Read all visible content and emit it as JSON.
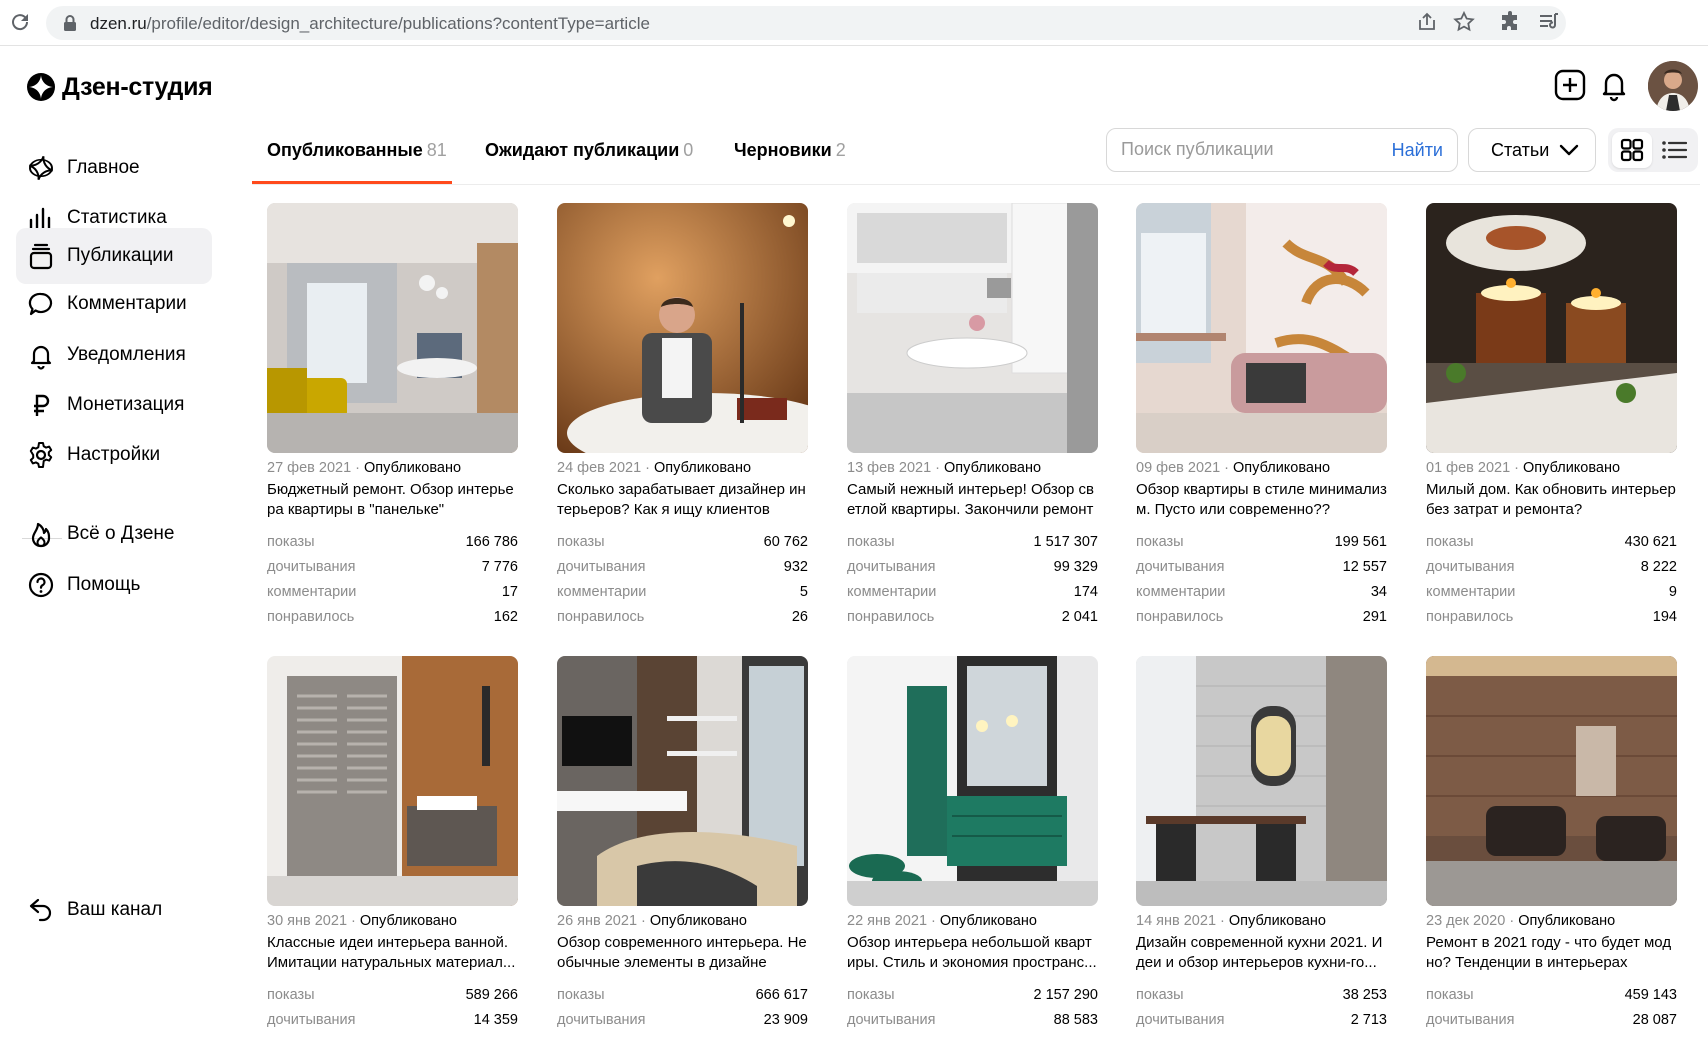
{
  "browser": {
    "url_host": "dzen.ru",
    "url_path": "/profile/editor/design_architecture/publications?contentType=article"
  },
  "app": {
    "logo_text": "Дзен-студия"
  },
  "sidebar": {
    "items": [
      {
        "label": "Главное",
        "icon": "dzen-logo-icon"
      },
      {
        "label": "Статистика",
        "icon": "bar-chart-icon"
      },
      {
        "label": "Публикации",
        "icon": "stack-icon"
      },
      {
        "label": "Комментарии",
        "icon": "comment-icon"
      },
      {
        "label": "Уведомления",
        "icon": "bell-icon"
      },
      {
        "label": "Монетизация",
        "icon": "ruble-icon"
      },
      {
        "label": "Настройки",
        "icon": "gear-icon"
      },
      {
        "label": "Всё о Дзене",
        "icon": "flame-icon"
      },
      {
        "label": "Помощь",
        "icon": "help-icon"
      },
      {
        "label": "Ваш канал",
        "icon": "back-arrow-icon"
      }
    ]
  },
  "tabs": [
    {
      "label": "Опубликованные",
      "count": "81",
      "active": true
    },
    {
      "label": "Ожидают публикации",
      "count": "0",
      "active": false
    },
    {
      "label": "Черновики",
      "count": "2",
      "active": false
    }
  ],
  "search": {
    "placeholder": "Поиск публикации",
    "button": "Найти"
  },
  "type_select": {
    "value": "Статьи"
  },
  "stat_labels": {
    "views": "показы",
    "reads": "дочитывания",
    "comments": "комментарии",
    "likes": "понравилось"
  },
  "cards": [
    {
      "date": "27 фев 2021",
      "status": "Опубликовано",
      "title": "Бюджетный ремонт. Обзор интерьера квартиры в \"панельке\"",
      "views": "166 786",
      "reads": "7 776",
      "comments": "17",
      "likes": "162"
    },
    {
      "date": "24 фев 2021",
      "status": "Опубликовано",
      "title": "Сколько зарабатывает дизайнер интерьеров? Как я ищу клиентов",
      "views": "60 762",
      "reads": "932",
      "comments": "5",
      "likes": "26"
    },
    {
      "date": "13 фев 2021",
      "status": "Опубликовано",
      "title": "Самый нежный интерьер! Обзор светлой квартиры. Закончили ремонт",
      "views": "1 517 307",
      "reads": "99 329",
      "comments": "174",
      "likes": "2 041"
    },
    {
      "date": "09 фев 2021",
      "status": "Опубликовано",
      "title": "Обзор квартиры в стиле минимализм. Пусто или современно??",
      "views": "199 561",
      "reads": "12 557",
      "comments": "34",
      "likes": "291"
    },
    {
      "date": "01 фев 2021",
      "status": "Опубликовано",
      "title": "Милый дом. Как обновить интерьер без затрат и ремонта?",
      "views": "430 621",
      "reads": "8 222",
      "comments": "9",
      "likes": "194"
    },
    {
      "date": "30 янв 2021",
      "status": "Опубликовано",
      "title": "Классные идеи интерьера ванной. Имитации натуральных материал...",
      "views": "589 266",
      "reads": "14 359",
      "comments": "",
      "likes": ""
    },
    {
      "date": "26 янв 2021",
      "status": "Опубликовано",
      "title": "Обзор современного интерьера. Необычные элементы в дизайне",
      "views": "666 617",
      "reads": "23 909",
      "comments": "",
      "likes": ""
    },
    {
      "date": "22 янв 2021",
      "status": "Опубликовано",
      "title": "Обзор интерьера небольшой квартиры. Стиль и экономия пространс...",
      "views": "2 157 290",
      "reads": "88 583",
      "comments": "",
      "likes": ""
    },
    {
      "date": "14 янв 2021",
      "status": "Опубликовано",
      "title": "Дизайн современной кухни 2021. Идеи и обзор интерьеров кухни-го...",
      "views": "38 253",
      "reads": "2 713",
      "comments": "",
      "likes": ""
    },
    {
      "date": "23 дек 2020",
      "status": "Опубликовано",
      "title": "Ремонт в 2021 году - что будет модно? Тенденции в интерьерах",
      "views": "459 143",
      "reads": "28 087",
      "comments": "",
      "likes": ""
    }
  ]
}
